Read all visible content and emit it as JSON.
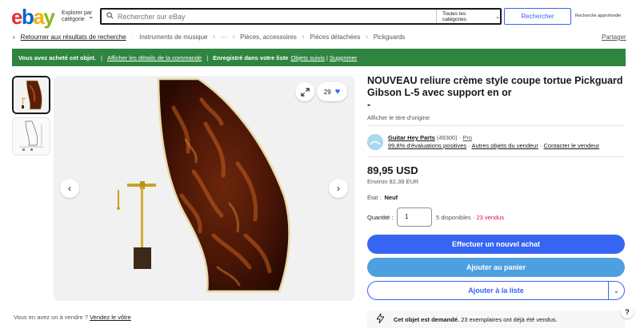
{
  "header": {
    "logo": [
      "e",
      "b",
      "a",
      "y"
    ],
    "browse_label_line1": "Explorer par",
    "browse_label_line2": "catégorie",
    "search_placeholder": "Rechercher sur eBay",
    "category_select": "Toutes les catégories",
    "search_button": "Rechercher",
    "advanced_search": "Recherche approfondie"
  },
  "breadcrumb": {
    "back_link": "Retourner aux résultats de recherche",
    "items": [
      "Instruments de musique",
      "Pièces, accessoires",
      "Pièces détachées",
      "Pickguards"
    ],
    "more": "···",
    "share": "Partager"
  },
  "banner": {
    "purchased": "Vous avez acheté cet objet.",
    "order_details": "Afficher les détails de la commande",
    "saved_prefix": "Enregistré dans votre liste",
    "followed_list": "Objets suivis",
    "delete": "Supprimer"
  },
  "gallery": {
    "watch_count": "29"
  },
  "listing": {
    "title": "NOUVEAU reliure crème style coupe tortue Pickguard Gibson L-5 avec support en or",
    "title_suffix": "-",
    "original_title_link": "Afficher le titre d'origine",
    "seller": {
      "name": "Guitar Hey Parts",
      "feedback_count": "(49300)",
      "badge": "Pro",
      "positive": "99,8% d'évaluations positives",
      "other_items": "Autres objets du vendeur",
      "contact": "Contacter le vendeur"
    },
    "price": "89,95 USD",
    "approx_price": "Environ 82,39 EUR",
    "condition_label": "État :",
    "condition_value": "Neuf",
    "quantity_label": "Quantité :",
    "quantity_value": "1",
    "available": "5 disponibles",
    "sold": "23 vendus",
    "buy_button": "Effectuer un nouvel achat",
    "cart_button": "Ajouter au panier",
    "watch_button": "Ajouter à la liste",
    "demand_bold": "Cet objet est demandé.",
    "demand_text": "23 exemplaires ont déjà été vendus."
  },
  "footer": {
    "sell_question": "Vous en avez un à vendre ?",
    "sell_link": "Vendez le vôtre"
  },
  "colors": {
    "accent": "#3665f3",
    "banner_green": "#2e8540",
    "sold_red": "#e0103a"
  }
}
